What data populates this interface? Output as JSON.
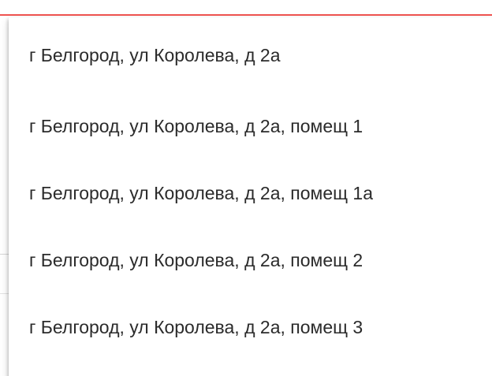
{
  "field": {
    "error_text": "",
    "hint_text": ""
  },
  "dropdown": {
    "options": [
      {
        "label": "г Белгород, ул Королева, д 2а"
      },
      {
        "label": "г Белгород, ул Королева, д 2а, помещ 1"
      },
      {
        "label": "г Белгород, ул Королева, д 2а, помещ 1а"
      },
      {
        "label": "г Белгород, ул Королева, д 2а, помещ 2"
      },
      {
        "label": "г Белгород, ул Королева, д 2а, помещ 3"
      }
    ]
  },
  "colors": {
    "error": "#e53935",
    "underline": "#ef5350",
    "option_text": "#2b2b2b"
  }
}
